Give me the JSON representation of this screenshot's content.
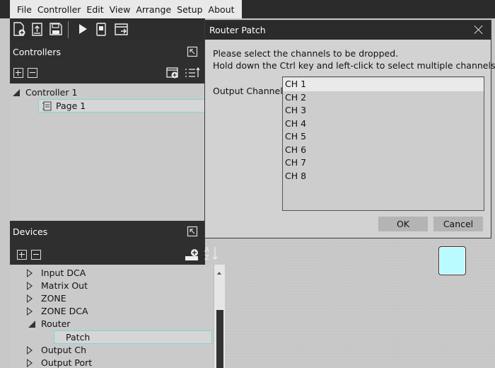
{
  "menu": [
    "File",
    "Controller",
    "Edit",
    "View",
    "Arrange",
    "Setup",
    "About"
  ],
  "toolbar": {
    "icons": [
      "new-file-icon",
      "open-file-icon",
      "save-icon",
      "play-icon",
      "device-icon",
      "export-icon"
    ]
  },
  "controllers": {
    "title": "Controllers",
    "tree": [
      {
        "label": "Controller 1",
        "expanded": true,
        "children": [
          {
            "label": "Page 1",
            "selected": true
          }
        ]
      }
    ]
  },
  "devices": {
    "title": "Devices",
    "items": [
      {
        "label": "Input DCA",
        "expanded": false
      },
      {
        "label": "Matrix Out",
        "expanded": false
      },
      {
        "label": "ZONE",
        "expanded": false
      },
      {
        "label": "ZONE DCA",
        "expanded": false
      },
      {
        "label": "Router",
        "expanded": true
      },
      {
        "label": "Patch",
        "child": true,
        "selected": true
      },
      {
        "label": "Output Ch",
        "expanded": false
      },
      {
        "label": "Output Port",
        "expanded": false
      }
    ]
  },
  "dialog": {
    "title": "Router Patch",
    "instruction_1": "Please select the channels to be dropped.",
    "instruction_2": "Hold down the Ctrl key and left-click to select multiple channels.",
    "output_label": "Output Channel",
    "channels": [
      "CH 1",
      "CH 2",
      "CH 3",
      "CH 4",
      "CH 5",
      "CH 6",
      "CH 7",
      "CH 8"
    ],
    "selected_channel": "CH 1",
    "ok_label": "OK",
    "cancel_label": "Cancel"
  },
  "colors": {
    "canvas_item": "#b9fbff",
    "selection_border": "#7fd6d6"
  }
}
